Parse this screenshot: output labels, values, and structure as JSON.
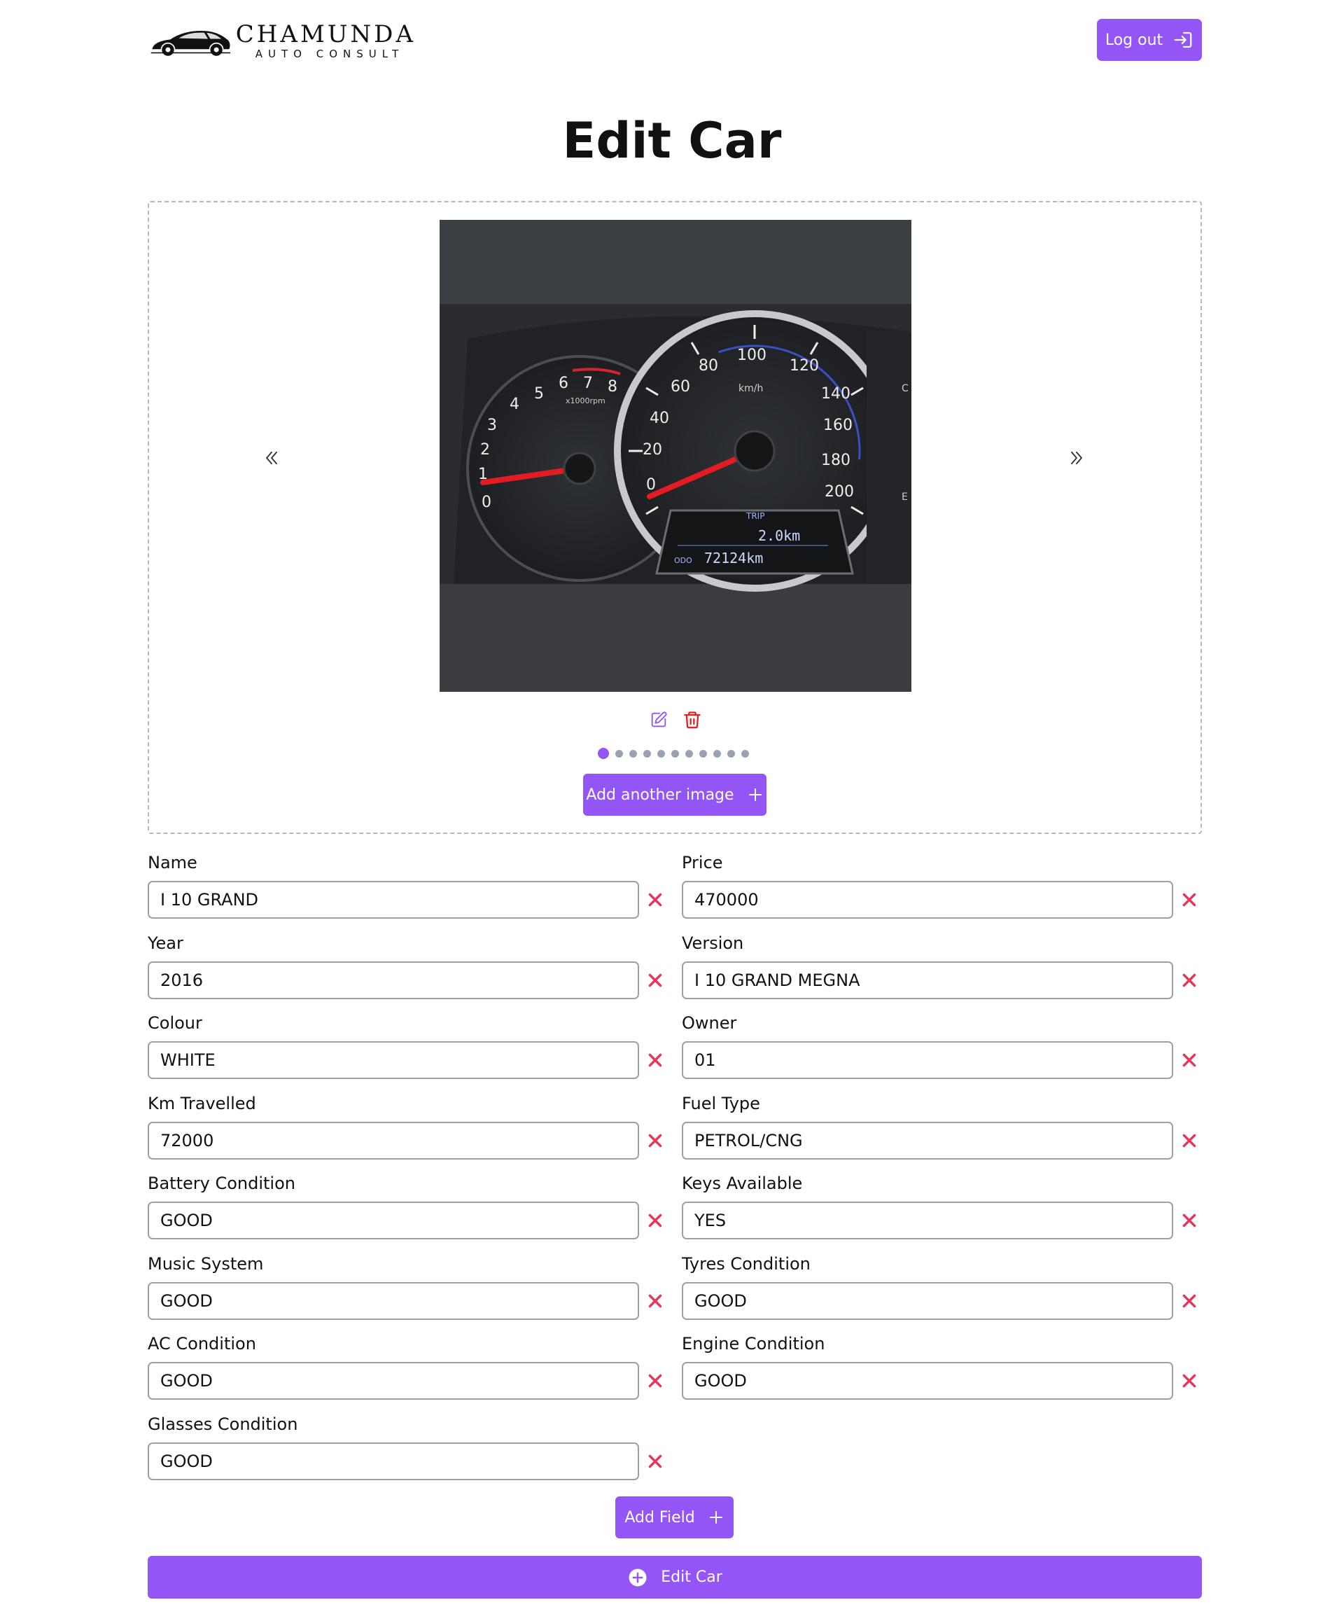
{
  "brand": {
    "name": "CHAMUNDA",
    "tagline": "AUTO CONSULT",
    "logo_icon": "sports-car-logo"
  },
  "header": {
    "logout_label": "Log out",
    "logout_icon": "logout-arrow-icon"
  },
  "page": {
    "title": "Edit Car"
  },
  "gallery": {
    "current_image": 1,
    "total_images": 11,
    "prev_icon": "double-chevron-left-icon",
    "next_icon": "double-chevron-right-icon",
    "edit_icon": "pencil-icon",
    "delete_icon": "trash-icon",
    "add_image_label": "Add another image"
  },
  "fields": [
    {
      "label": "Name",
      "value": "I 10 GRAND"
    },
    {
      "label": "Price",
      "value": "470000"
    },
    {
      "label": "Year",
      "value": "2016"
    },
    {
      "label": "Version",
      "value": "I 10 GRAND MEGNA"
    },
    {
      "label": "Colour",
      "value": "WHITE"
    },
    {
      "label": "Owner",
      "value": "01"
    },
    {
      "label": "Km Travelled",
      "value": "72000"
    },
    {
      "label": "Fuel Type",
      "value": "PETROL/CNG"
    },
    {
      "label": "Battery Condition",
      "value": "GOOD"
    },
    {
      "label": "Keys Available",
      "value": "YES"
    },
    {
      "label": "Music System",
      "value": "GOOD"
    },
    {
      "label": "Tyres Condition",
      "value": "GOOD"
    },
    {
      "label": "AC Condition",
      "value": "GOOD"
    },
    {
      "label": "Engine Condition",
      "value": "GOOD"
    },
    {
      "label": "Glasses Condition",
      "value": "GOOD"
    }
  ],
  "actions": {
    "add_field_label": "Add Field",
    "submit_label": "Edit Car"
  },
  "colors": {
    "accent": "#9455f7",
    "remove": "#e8335a",
    "delete": "#e02424",
    "input_border": "#9ea0a6"
  }
}
